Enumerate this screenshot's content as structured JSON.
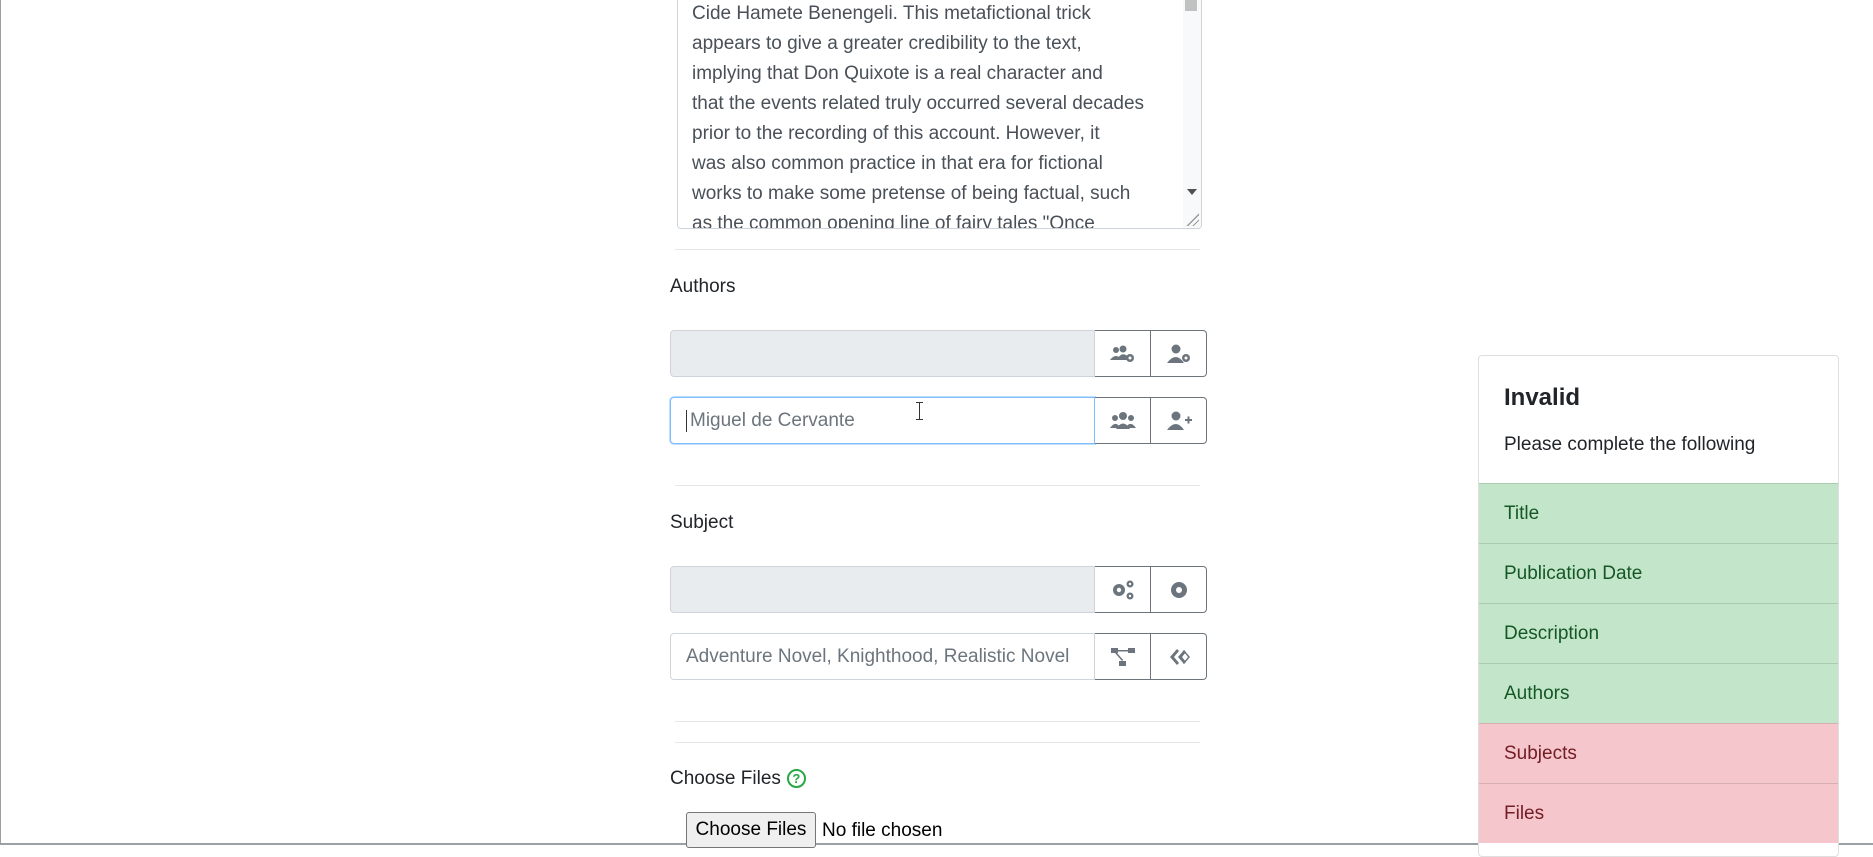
{
  "description": {
    "text": "Cide Hamete Benengeli. This metafictional trick\nappears to give a greater credibility to the text,\nimplying that Don Quixote is a real character and\nthat the events related truly occurred several decades\nprior to the recording of this account. However, it\nwas also common practice in that era for fictional\nworks to make some pretense of being factual, such\nas the common opening line of fairy tales \"Once"
  },
  "authors": {
    "label": "Authors",
    "readonly_value": "",
    "input_placeholder": "Miguel de Cervante",
    "icons": [
      "users-cog-icon",
      "user-cog-icon",
      "users-icon",
      "user-plus-icon"
    ]
  },
  "subject": {
    "label": "Subject",
    "readonly_value": "",
    "input_placeholder": "Adventure Novel, Knighthood, Realistic Novel",
    "icons": [
      "cogs-icon",
      "cog-icon",
      "project-diagram-icon",
      "hubspot-icon"
    ]
  },
  "files": {
    "label": "Choose Files",
    "help_glyph": "?",
    "button_label": "Choose Files",
    "status": "No file chosen"
  },
  "validation": {
    "title": "Invalid",
    "subtitle": "Please complete the following",
    "items": [
      {
        "label": "Title",
        "status": "valid"
      },
      {
        "label": "Publication Date",
        "status": "valid"
      },
      {
        "label": "Description",
        "status": "valid"
      },
      {
        "label": "Authors",
        "status": "valid"
      },
      {
        "label": "Subjects",
        "status": "invalid"
      },
      {
        "label": "Files",
        "status": "invalid"
      }
    ],
    "colors": {
      "valid_bg": "#c3e6cb",
      "valid_text": "#155724",
      "invalid_bg": "#f5c6cb",
      "invalid_text": "#721c24"
    }
  }
}
